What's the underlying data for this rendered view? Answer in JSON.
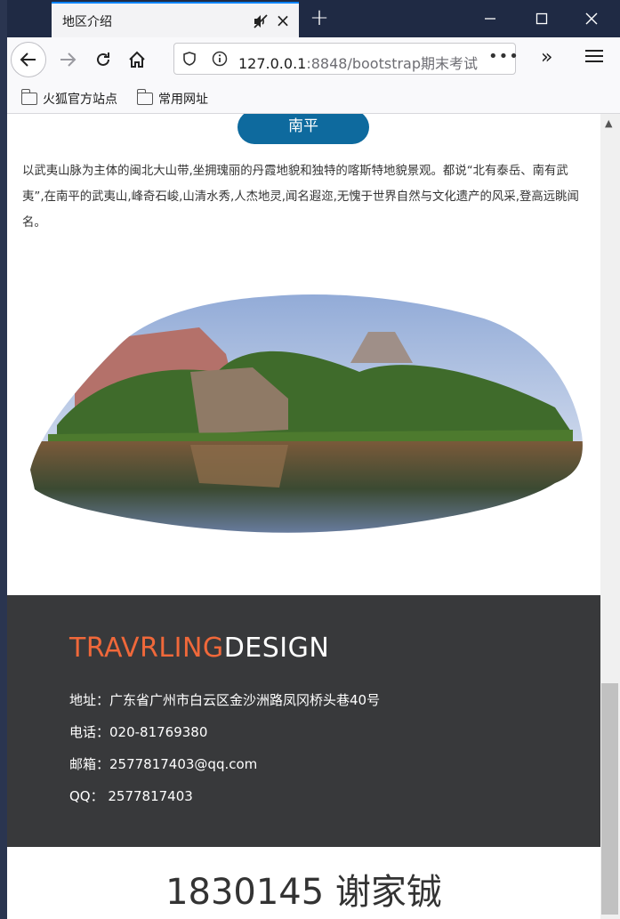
{
  "window": {
    "tab_title": "地区介绍",
    "tab_close": "×",
    "new_tab": "+",
    "min_icon": "minimize-icon",
    "max_icon": "maximize-icon",
    "close_icon": "close-icon"
  },
  "navbar": {
    "url_host": "127.0.0.1",
    "url_rest": ":8848/bootstrap期末考试",
    "url_more": "•••",
    "extensions": "»"
  },
  "bookmarks": [
    {
      "label": "火狐官方站点"
    },
    {
      "label": "常用网址"
    }
  ],
  "page": {
    "city_button": "南平",
    "intro": "以武夷山脉为主体的闽北大山带,坐拥瑰丽的丹霞地貌和独特的喀斯特地貌景观。都说“北有泰岳、南有武夷”,在南平的武夷山,峰奇石峻,山清水秀,人杰地灵,闻名遐迩,无愧于世界自然与文化遗产的风采,登高远眺闻名。",
    "photo_icon": "landscape-photo"
  },
  "footer": {
    "logo_part1": "TRAVRLING",
    "logo_part2": "DESIGN",
    "address": "地址：广东省广州市白云区金沙洲路凤冈桥头巷40号",
    "phone": "电话：020-81769380",
    "email": "邮箱：2577817403@qq.com",
    "qq": "QQ：  2577817403"
  },
  "signature": "1830145 谢家铖",
  "colors": {
    "accent": "#0e6a9e",
    "logo_orange": "#f0683a",
    "footer_bg": "#38393b",
    "titlebar": "#1f2a44"
  }
}
